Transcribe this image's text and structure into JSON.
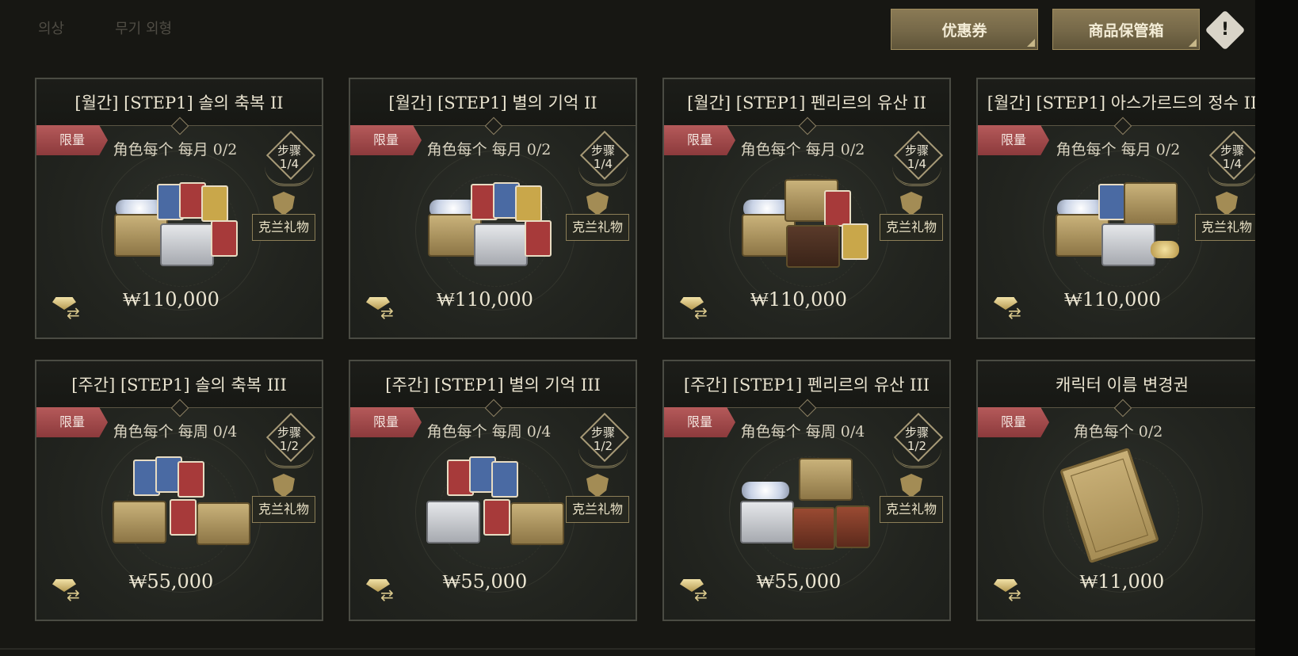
{
  "tabs": [
    "의상",
    "무기 외형"
  ],
  "header": {
    "coupon_label": "优惠券",
    "storage_label": "商品保管箱",
    "notice_symbol": "!"
  },
  "products": [
    {
      "title": "[월간] [STEP1] 솔의 축복 II",
      "ribbon": "限量",
      "limit": "角色每个 每月 0/2",
      "step_label": "步骤",
      "step": "1/4",
      "gift_label": "克兰礼物",
      "price": "₩110,000"
    },
    {
      "title": "[월간] [STEP1] 별의 기억 II",
      "ribbon": "限量",
      "limit": "角色每个 每月 0/2",
      "step_label": "步骤",
      "step": "1/4",
      "gift_label": "克兰礼物",
      "price": "₩110,000"
    },
    {
      "title": "[월간] [STEP1] 펜리르의 유산 II",
      "ribbon": "限量",
      "limit": "角色每个 每月 0/2",
      "step_label": "步骤",
      "step": "1/4",
      "gift_label": "克兰礼物",
      "price": "₩110,000"
    },
    {
      "title": "[월간] [STEP1] 아스가르드의 정수 II",
      "ribbon": "限量",
      "limit": "角色每个 每月 0/2",
      "step_label": "步骤",
      "step": "1/4",
      "gift_label": "克兰礼物",
      "price": "₩110,000"
    },
    {
      "title": "[주간] [STEP1] 솔의 축복 III",
      "ribbon": "限量",
      "limit": "角色每个 每周 0/4",
      "step_label": "步骤",
      "step": "1/2",
      "gift_label": "克兰礼物",
      "price": "₩55,000"
    },
    {
      "title": "[주간] [STEP1] 별의 기억 III",
      "ribbon": "限量",
      "limit": "角色每个 每周 0/4",
      "step_label": "步骤",
      "step": "1/2",
      "gift_label": "克兰礼物",
      "price": "₩55,000"
    },
    {
      "title": "[주간] [STEP1] 펜리르의 유산 III",
      "ribbon": "限量",
      "limit": "角色每个 每周 0/4",
      "step_label": "步骤",
      "step": "1/2",
      "gift_label": "克兰礼物",
      "price": "₩55,000"
    },
    {
      "title": "캐릭터 이름 변경권",
      "ribbon": "限量",
      "limit": "角色每个 0/2",
      "price": "₩11,000"
    }
  ],
  "colors": {
    "background": "#171713",
    "card_border": "#4a4b43",
    "ribbon": "#a04a4b",
    "button_gold": "#7d6e4c",
    "text": "#ece6d2"
  }
}
